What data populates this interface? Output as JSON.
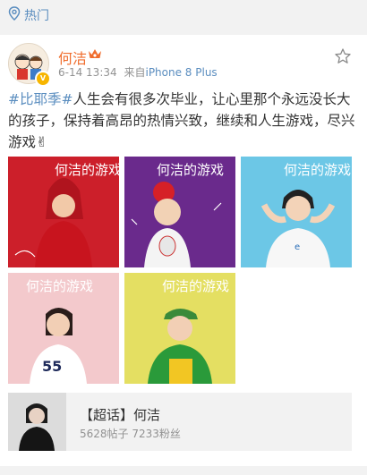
{
  "header": {
    "label": "热门",
    "icon": "location-pin-icon"
  },
  "post": {
    "username": "何洁",
    "time": "6-14 13:34",
    "source_prefix": "来自",
    "device": "iPhone 8 Plus",
    "hashtag": "#比耶季#",
    "body": "人生会有很多次毕业，让心里那个永远没长大的孩子，保持着高昂的热情兴致，继续和人生游戏，尽兴游戏",
    "emoji": "✌",
    "images": [
      {
        "caption": "何洁的游戏",
        "bg": "#cc1f2a"
      },
      {
        "caption": "何洁的游戏",
        "bg": "#6a2a8c"
      },
      {
        "caption": "何洁的游戏",
        "bg": "#6cc7e6"
      },
      {
        "caption": "何洁的游戏",
        "bg": "#f3c9cc"
      },
      {
        "caption": "何洁的游戏",
        "bg": "#e4df62"
      }
    ]
  },
  "topic": {
    "title": "【超话】何洁",
    "stats": "5628帖子 7233粉丝"
  }
}
